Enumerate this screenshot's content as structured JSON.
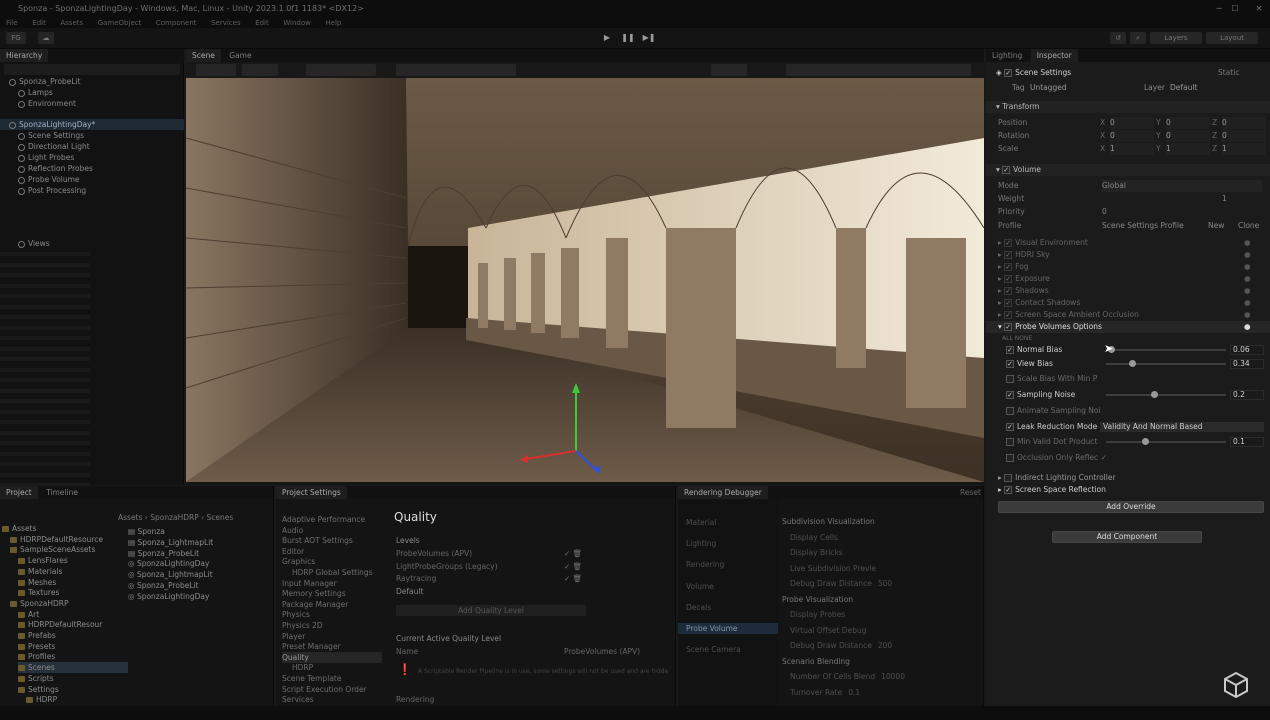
{
  "window": {
    "title": "Sponza - SponzaLightingDay - Windows, Mac, Linux - Unity 2023.1.0f1 1183* <DX12>",
    "controls": [
      "─",
      "☐",
      "✕"
    ]
  },
  "menu": [
    "File",
    "Edit",
    "Assets",
    "GameObject",
    "Component",
    "Services",
    "Edit",
    "Window",
    "Help"
  ],
  "toolbar": {
    "account": "FG",
    "layers": "Layers",
    "layout": "Layout"
  },
  "hierarchy": {
    "tab": "Hierarchy",
    "rows": [
      {
        "label": "Sponza_ProbeLit",
        "indent": 1,
        "style": "scene"
      },
      {
        "label": "Lamps",
        "indent": 2,
        "style": "obj"
      },
      {
        "label": "Environment",
        "indent": 2,
        "style": "obj"
      },
      {
        "label": "SponzaLightingDay*",
        "indent": 1,
        "style": "sel"
      },
      {
        "label": "Scene Settings",
        "indent": 2,
        "style": "obj"
      },
      {
        "label": "Directional Light",
        "indent": 2,
        "style": "obj"
      },
      {
        "label": "Light Probes",
        "indent": 2,
        "style": "obj"
      },
      {
        "label": "Reflection Probes",
        "indent": 2,
        "style": "obj"
      },
      {
        "label": "Probe Volume",
        "indent": 2,
        "style": "obj"
      },
      {
        "label": "Post Processing",
        "indent": 2,
        "style": "obj"
      },
      {
        "label": "Views",
        "indent": 2,
        "style": "obj"
      }
    ]
  },
  "scene": {
    "tabs": [
      "Scene",
      "Game"
    ]
  },
  "inspector": {
    "tabs": [
      "Lighting",
      "Inspector"
    ],
    "object_name": "Scene Settings",
    "static_label": "Static",
    "tag_label": "Tag",
    "tag_value": "Untagged",
    "layer_label": "Layer",
    "layer_value": "Default",
    "transform": {
      "header": "Transform",
      "position_label": "Position",
      "rotation_label": "Rotation",
      "scale_label": "Scale",
      "position": [
        "0",
        "0",
        "0"
      ],
      "rotation": [
        "0",
        "0",
        "0"
      ],
      "scale": [
        "1",
        "1",
        "1"
      ]
    },
    "volume": {
      "header": "Volume",
      "mode_label": "Mode",
      "mode_value": "Global",
      "weight_label": "Weight",
      "weight_value": "1",
      "priority_label": "Priority",
      "priority_value": "0",
      "profile_label": "Profile",
      "profile_value": "Scene Settings Profile",
      "new_label": "New",
      "clone_label": "Clone"
    },
    "overrides": [
      "Visual Environment",
      "HDRI Sky",
      "Fog",
      "Exposure",
      "Shadows",
      "Contact Shadows",
      "Screen Space Ambient Occlusion"
    ],
    "probe": {
      "header": "Probe Volumes Options",
      "all": "ALL",
      "none": "NONE",
      "normal_bias_label": "Normal Bias",
      "normal_bias_value": "0.06",
      "normal_bias_level": 0.02,
      "view_bias_label": "View Bias",
      "view_bias_value": "0.34",
      "view_bias_level": 0.2,
      "scale_bias_label": "Scale Bias With Min P",
      "sampling_noise_label": "Sampling Noise",
      "sampling_noise_value": "0.2",
      "sampling_noise_level": 0.4,
      "animate_noise_label": "Animate Sampling Noi",
      "leak_label": "Leak Reduction Mode",
      "leak_value": "Validity And Normal Based",
      "min_valid_label": "Min Valid Dot Product",
      "min_valid_value": "0.1",
      "min_valid_level": 0.32,
      "occlusion_label": "Occlusion Only Reflec"
    },
    "indirect": "Indirect Lighting Controller",
    "ssr": "Screen Space Reflection",
    "add_override": "Add Override",
    "add_component": "Add Component"
  },
  "project": {
    "tabs": [
      "Project",
      "Timeline"
    ],
    "path": [
      "Assets",
      "SponzaHDRP",
      "Scenes"
    ],
    "tree": [
      {
        "label": "Assets",
        "indent": 0
      },
      {
        "label": "HDRPDefaultResource",
        "indent": 1
      },
      {
        "label": "SampleSceneAssets",
        "indent": 1
      },
      {
        "label": "LensFlares",
        "indent": 2
      },
      {
        "label": "Materials",
        "indent": 2
      },
      {
        "label": "Meshes",
        "indent": 2
      },
      {
        "label": "Textures",
        "indent": 2
      },
      {
        "label": "SponzaHDRP",
        "indent": 1
      },
      {
        "label": "Art",
        "indent": 2
      },
      {
        "label": "HDRPDefaultResour",
        "indent": 2
      },
      {
        "label": "Prefabs",
        "indent": 2
      },
      {
        "label": "Presets",
        "indent": 2
      },
      {
        "label": "Profiles",
        "indent": 2
      },
      {
        "label": "Scenes",
        "indent": 2
      },
      {
        "label": "Scripts",
        "indent": 2
      },
      {
        "label": "Settings",
        "indent": 2
      },
      {
        "label": "HDRP",
        "indent": 3
      }
    ],
    "files": [
      "Sponza",
      "Sponza_LightmapLit",
      "Sponza_ProbeLit",
      "SponzaLightingDay",
      "Sponza_LightmapLit",
      "Sponza_ProbeLit",
      "SponzaLightingDay"
    ]
  },
  "settings": {
    "tab": "Project Settings",
    "categories": [
      "Adaptive Performance",
      "Audio",
      "Burst AOT Settings",
      "Editor",
      "Graphics",
      "HDRP Global Settings",
      "Input Manager",
      "Memory Settings",
      "Package Manager",
      "Physics",
      "Physics 2D",
      "Player",
      "Preset Manager",
      "Quality",
      "HDRP",
      "Scene Template",
      "Script Execution Order",
      "Services"
    ],
    "title": "Quality",
    "levels_label": "Levels",
    "levels": [
      "ProbeVolumes (APV)",
      "LightProbeGroups (Legacy)",
      "Raytracing"
    ],
    "default_label": "Default",
    "add_level": "Add Quality Level",
    "current_label": "Current Active Quality Level",
    "name_label": "Name",
    "name_value": "ProbeVolumes (APV)",
    "warning": "A Scriptable Render Pipeline is in use, some settings will not be used and are hidden",
    "rendering_label": "Rendering"
  },
  "debugger": {
    "tab": "Rendering Debugger",
    "reset": "Reset",
    "menu": [
      "Material",
      "Lighting",
      "Rendering",
      "Volume",
      "Decals",
      "Probe Volume",
      "Scene Camera"
    ],
    "active": "Probe Volume",
    "rows": [
      {
        "label": "Subdivision Visualization",
        "value": "",
        "head": true
      },
      {
        "label": "Display Cells",
        "value": ""
      },
      {
        "label": "Display Bricks",
        "value": ""
      },
      {
        "label": "Live Subdivision Previe",
        "value": ""
      },
      {
        "label": "Debug Draw Distance",
        "value": "500"
      },
      {
        "label": "Probe Visualization",
        "value": "",
        "head": true
      },
      {
        "label": "Display Probes",
        "value": ""
      },
      {
        "label": "Virtual Offset Debug",
        "value": ""
      },
      {
        "label": "Debug Draw Distance",
        "value": "200"
      },
      {
        "label": "Scenario Blending",
        "value": "",
        "head": true
      },
      {
        "label": "Number Of Cells Blend",
        "value": "10000"
      },
      {
        "label": "Turnover Rate",
        "value": "0.1"
      }
    ]
  }
}
